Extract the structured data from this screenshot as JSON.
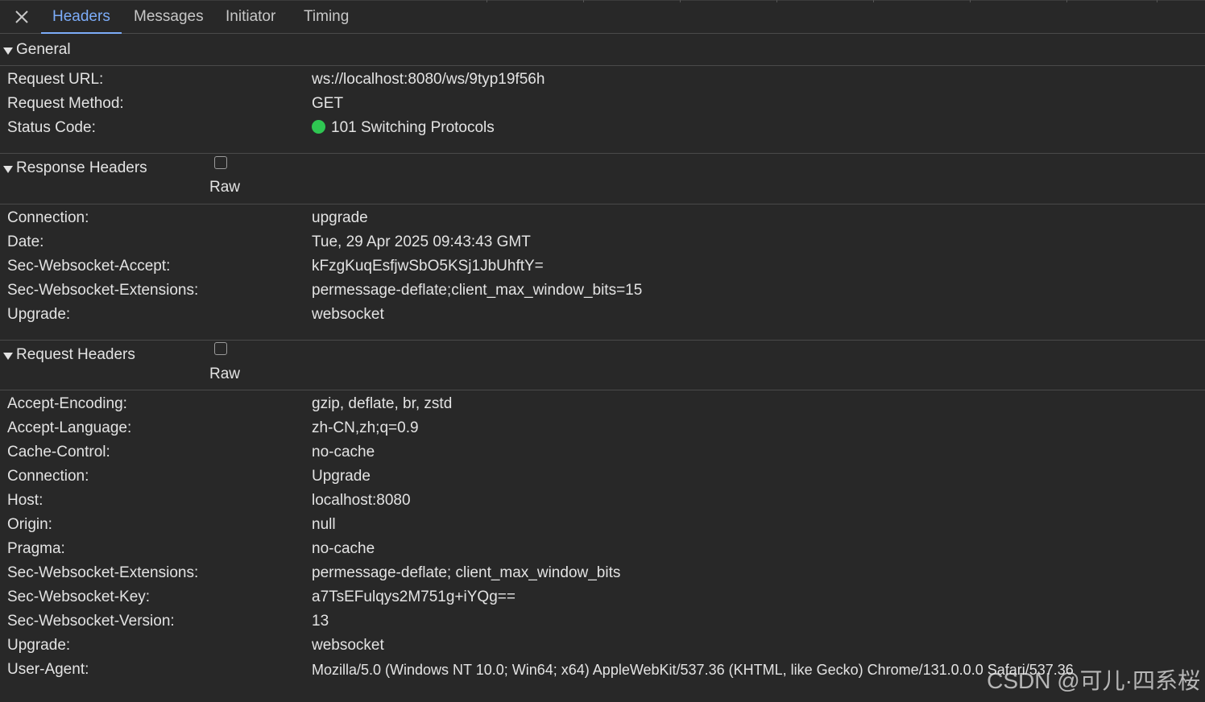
{
  "tabs": [
    "Headers",
    "Messages",
    "Initiator",
    "Timing"
  ],
  "active_tab": "Headers",
  "general": {
    "title": "General",
    "rows": [
      {
        "k": "Request URL:",
        "v": "ws://localhost:8080/ws/9typ19f56h"
      },
      {
        "k": "Request Method:",
        "v": "GET"
      },
      {
        "k": "Status Code:",
        "v": "101 Switching Protocols"
      }
    ],
    "status_color": "#2fc652"
  },
  "response_headers": {
    "title": "Response Headers",
    "raw_label": "Raw",
    "raw_checked": false,
    "rows": [
      {
        "k": "Connection:",
        "v": "upgrade"
      },
      {
        "k": "Date:",
        "v": "Tue, 29 Apr 2025 09:43:43 GMT"
      },
      {
        "k": "Sec-Websocket-Accept:",
        "v": "kFzgKuqEsfjwSbO5KSj1JbUhftY="
      },
      {
        "k": "Sec-Websocket-Extensions:",
        "v": "permessage-deflate;client_max_window_bits=15"
      },
      {
        "k": "Upgrade:",
        "v": "websocket"
      }
    ]
  },
  "request_headers": {
    "title": "Request Headers",
    "raw_label": "Raw",
    "raw_checked": false,
    "rows": [
      {
        "k": "Accept-Encoding:",
        "v": "gzip, deflate, br, zstd"
      },
      {
        "k": "Accept-Language:",
        "v": "zh-CN,zh;q=0.9"
      },
      {
        "k": "Cache-Control:",
        "v": "no-cache"
      },
      {
        "k": "Connection:",
        "v": "Upgrade"
      },
      {
        "k": "Host:",
        "v": "localhost:8080"
      },
      {
        "k": "Origin:",
        "v": "null"
      },
      {
        "k": "Pragma:",
        "v": "no-cache"
      },
      {
        "k": "Sec-Websocket-Extensions:",
        "v": "permessage-deflate; client_max_window_bits"
      },
      {
        "k": "Sec-Websocket-Key:",
        "v": "a7TsEFulqys2M751g+iYQg=="
      },
      {
        "k": "Sec-Websocket-Version:",
        "v": "13"
      },
      {
        "k": "Upgrade:",
        "v": "websocket"
      },
      {
        "k": "User-Agent:",
        "v": "Mozilla/5.0 (Windows NT 10.0; Win64; x64) AppleWebKit/537.36 (KHTML, like Gecko) Chrome/131.0.0.0 Safari/537.36"
      }
    ]
  },
  "watermark": "CSDN @可儿·四系桜",
  "colors": {
    "background": "#282828",
    "accent": "#7cacf8",
    "text": "#e3e3e3",
    "divider": "#4a4a4a"
  }
}
